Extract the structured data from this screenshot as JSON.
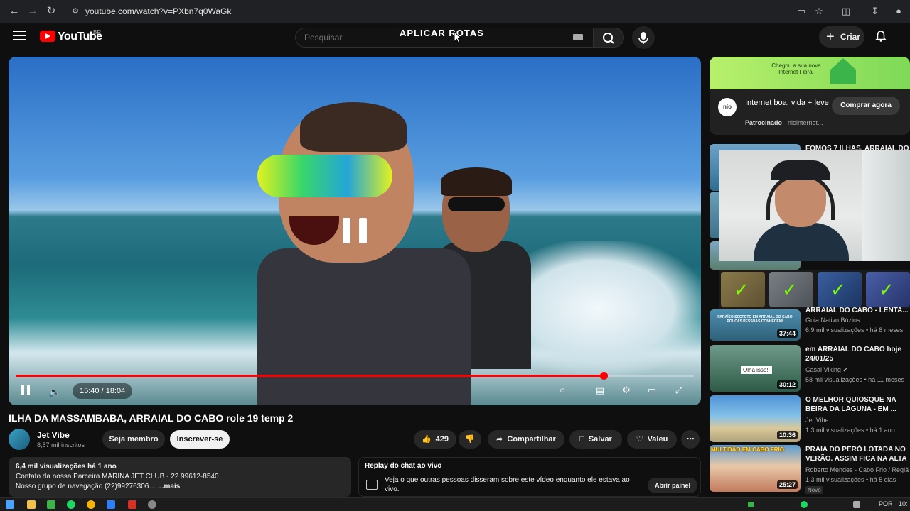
{
  "browser": {
    "url": "youtube.com/watch?v=PXbn7q0WaGk"
  },
  "header": {
    "logo_text": "YouTube",
    "country": "BR",
    "search_placeholder": "Pesquisar",
    "overlay_title": "APLICAR ROTAS",
    "create_label": "Criar"
  },
  "video": {
    "current_time": "15:40",
    "duration": "18:04",
    "time_display": "15:40 / 18:04",
    "progress_fraction": 0.867,
    "title": "ILHA DA MASSAMBABA, ARRAIAL DO CABO role 19 temp 2"
  },
  "channel": {
    "name": "Jet Vibe",
    "subscribers": "8,57 mil inscritos",
    "member_label": "Seja membro",
    "subscribe_label": "Inscrever-se"
  },
  "actions": {
    "likes": "429",
    "share_label": "Compartilhar",
    "save_label": "Salvar",
    "thanks_label": "Valeu"
  },
  "description": {
    "stats": "6,4 mil visualizações  há 1 ano",
    "line1": "Contato da nossa Parceira MARINA JET CLUB - 22 99612-8540",
    "line2": "Nosso grupo de navegação (22)99276306…",
    "more_label": "...mais"
  },
  "chat_replay": {
    "title": "Replay do chat ao vivo",
    "text": "Veja o que outras pessoas disseram sobre este vídeo enquanto ele estava ao vivo.",
    "button": "Abrir painel"
  },
  "ad": {
    "banner_text": "Chegou a sua nova Internet Fibra.",
    "logo_text": "nio",
    "title": "Internet boa, vida + leve",
    "sponsored": "Patrocinado",
    "advertiser": "niointernet...",
    "cta": "Comprar agora"
  },
  "recommendations": [
    {
      "title": "FOMOS 7 ILHAS, ARRAIAL DO",
      "channel": "",
      "meta": "",
      "duration": ""
    },
    {
      "title": "ARRAIAL DO CABO - LENTA...",
      "channel": "Guia Nativo Búzios",
      "meta": "6,9 mil visualizações • há 8 meses",
      "duration": "37:44",
      "thumb_text": "PARAÍSO SECRETO EM ARRAIAL DO CABO POUCAS PESSOAS CONHECEM!"
    },
    {
      "title": "em ARRAIAL DO CABO hoje 24/01/25",
      "channel": "Casal Viking",
      "meta": "58 mil visualizações • há 11 meses",
      "duration": "30:12",
      "thumb_text": "Olha isso!!"
    },
    {
      "title": "O MELHOR QUIOSQUE NA BEIRA DA LAGUNA - EM ...",
      "channel": "Jet Vibe",
      "meta": "1,3 mil visualizações • há 1 ano",
      "duration": "10:36"
    },
    {
      "title": "PRAIA DO PERÓ LOTADA NO VERÃO. ASSIM FICA NA ALTA",
      "channel": "Roberto Mendes - Cabo Frio / Regiã",
      "meta": "1,3 mil visualizações • há 5 dias",
      "duration": "25:27",
      "badge": "Novo",
      "thumb_text": "MULTIDÃO EM CABO FRIO"
    }
  ],
  "taskbar": {
    "lang": "POR",
    "clock": "10:"
  }
}
